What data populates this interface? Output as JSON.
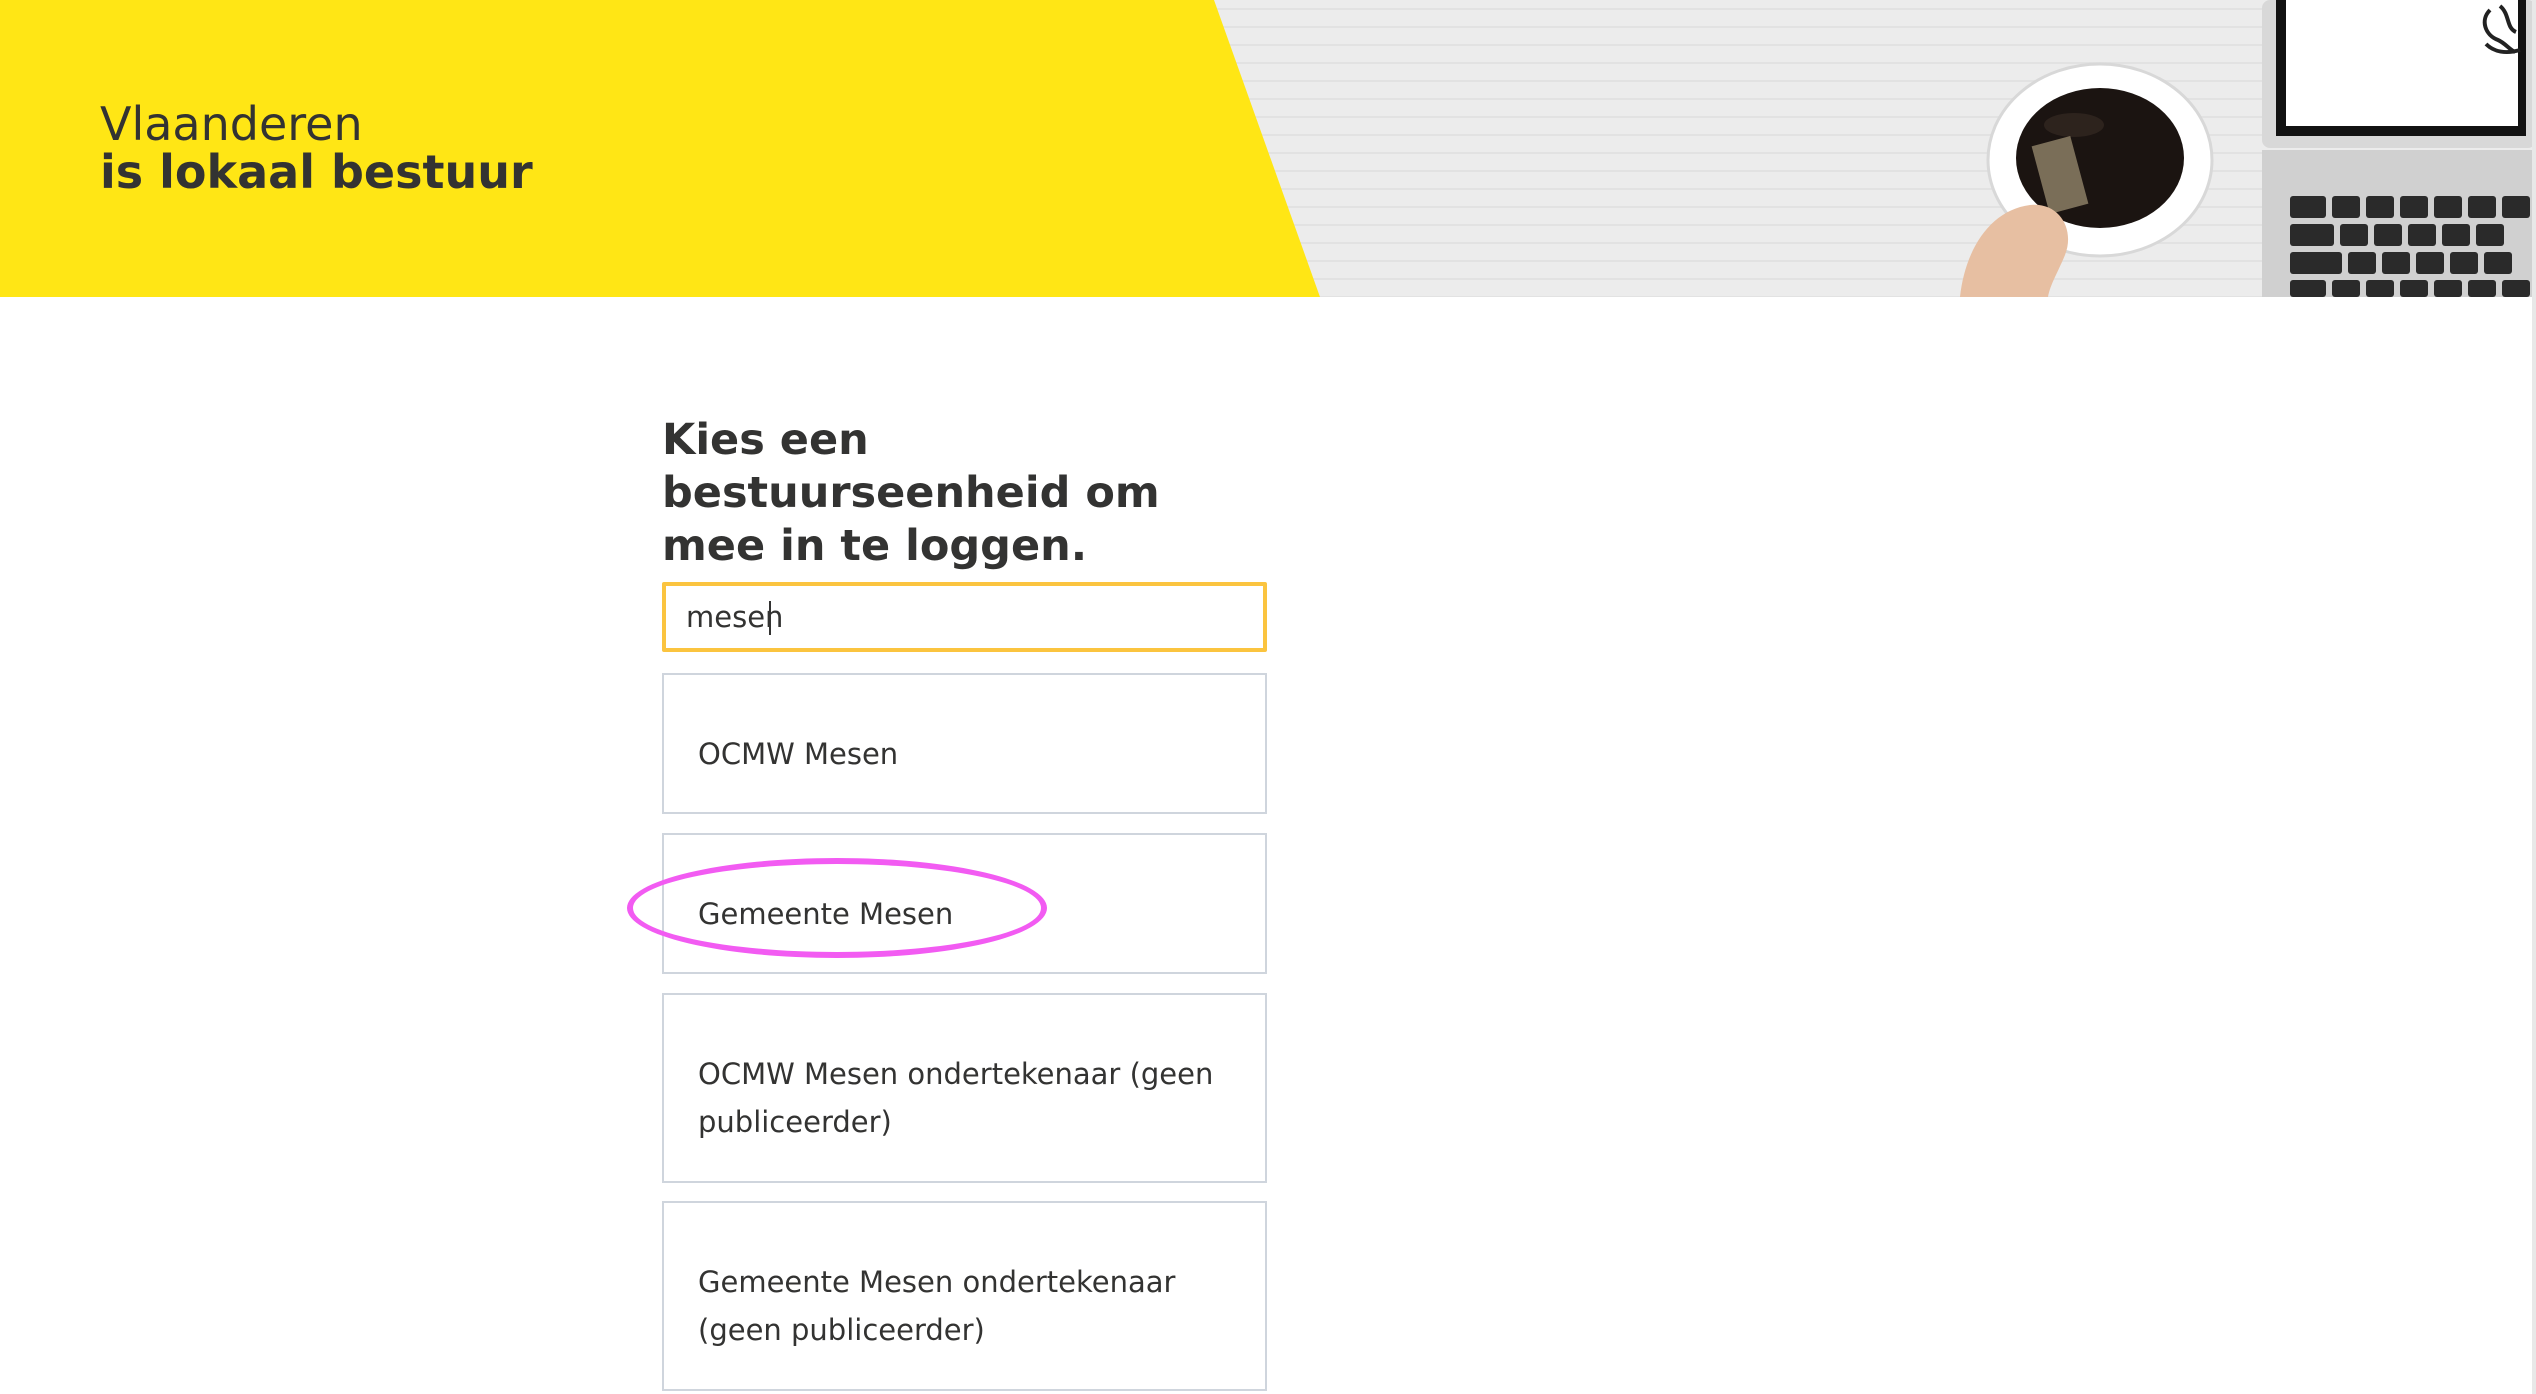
{
  "header": {
    "brand_line1": "Vlaanderen",
    "brand_line2": "is lokaal bestuur",
    "colors": {
      "yellow": "#ffe615",
      "text": "#333332"
    }
  },
  "main": {
    "title": "Kies een bestuurseenheid om mee in te loggen.",
    "search": {
      "value": "mesen",
      "border_color": "#fbc43f"
    },
    "options": [
      {
        "label": "OCMW Mesen"
      },
      {
        "label": "Gemeente Mesen"
      },
      {
        "label": "OCMW Mesen ondertekenaar (geen publiceerder)"
      },
      {
        "label": "Gemeente Mesen ondertekenaar (geen publiceerder)"
      }
    ]
  },
  "annotation": {
    "type": "ellipse-highlight",
    "target": "Gemeente Mesen",
    "color": "#f25bf2"
  },
  "icons": [
    "lion-logo-icon"
  ]
}
